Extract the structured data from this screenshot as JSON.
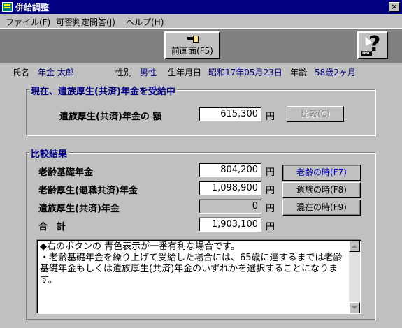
{
  "window": {
    "title": "併給調整",
    "close_label": "×"
  },
  "menu": {
    "items": [
      "ファイル(F)",
      "可否判定問答(J)",
      "ヘルプ(H)"
    ]
  },
  "toolbar": {
    "prev_label": "前画面(F5)",
    "help_icon": "help-question-icon",
    "help_badge": "IMC"
  },
  "person": {
    "name_label": "氏名",
    "name_value": "年金 太郎",
    "sex_label": "性別",
    "sex_value": "男性",
    "birth_label": "生年月日",
    "birth_value": "昭和17年05月23日",
    "age_label": "年齢",
    "age_value": "58歳2ヶ月"
  },
  "current": {
    "title": "現在、遺族厚生(共済)年金を受給中",
    "amount_label": "遺族厚生(共済)年金の 額",
    "amount_value": "615,300",
    "unit": "円",
    "compare_label": "比較(C)"
  },
  "compare": {
    "title": "比較結果",
    "rows": [
      {
        "label": "老齢基礎年金",
        "value": "804,200",
        "unit": "円"
      },
      {
        "label": "老齢厚生(退職共済)年金",
        "value": "1,098,900",
        "unit": "円"
      },
      {
        "label": "遺族厚生(共済)年金",
        "value": "0",
        "unit": "円"
      },
      {
        "label": "合　計",
        "value": "1,903,100",
        "unit": "円"
      }
    ],
    "buttons": [
      "老齢の時(F7)",
      "遺族の時(F8)",
      "混在の時(F9)"
    ]
  },
  "memo": "◆右のボタンの 青色表示が一番有利な場合です。\n・老齢基礎年金を繰り上げて受給した場合には、65歳に達するまでは老齢基礎年金もしくは遺族厚生(共済)年金のいずれかを選択することになります。",
  "colors": {
    "title_bar": "#000080",
    "label_blue": "#000080",
    "active_button_text": "#0000c0"
  }
}
